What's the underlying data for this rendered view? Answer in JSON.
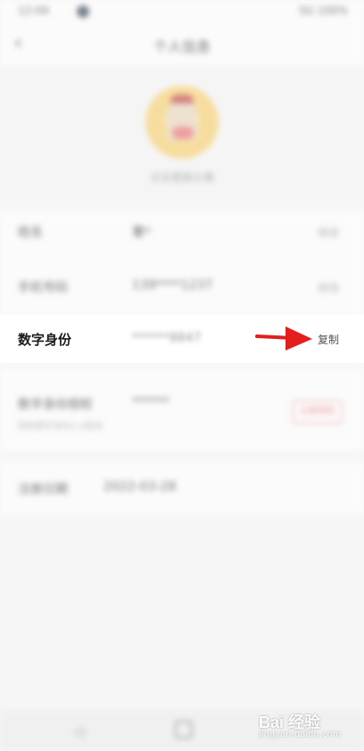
{
  "status_bar": {
    "time": "12:09",
    "right": "5G 100%"
  },
  "nav": {
    "title": "个人信息"
  },
  "profile": {
    "nickname": "点击更换头像"
  },
  "rows": [
    {
      "label": "姓名",
      "value": "曹*",
      "action": "修改"
    },
    {
      "label": "手机号码",
      "value": "139****1237",
      "action": "修改"
    },
    {
      "label": "数字身份",
      "value": "******8847",
      "action": "复制"
    },
    {
      "label": "数字身份授权",
      "value": "******",
      "sub": "授权数字身份2.0版本",
      "action": "立即授权"
    },
    {
      "label": "注册日期",
      "value": "2022-03-28"
    }
  ],
  "watermark": {
    "brand": "Bai 经验",
    "url": "jingyan.baidu.com"
  },
  "colors": {
    "arrow": "#e41d1d",
    "accent": "#e06060"
  }
}
